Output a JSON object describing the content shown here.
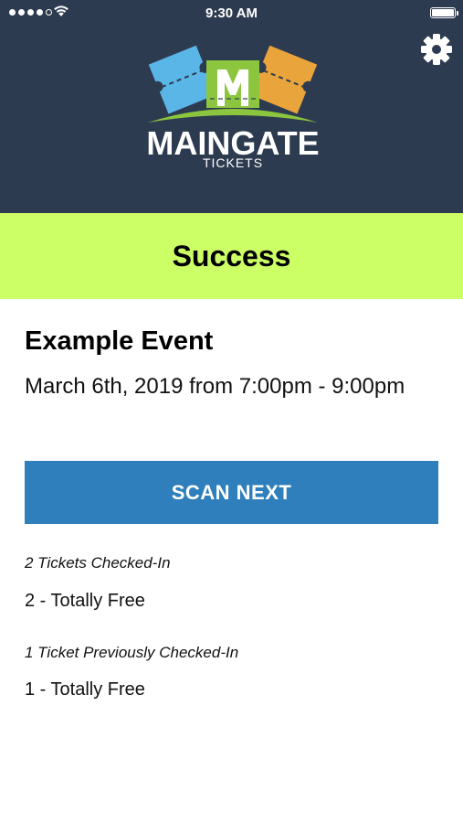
{
  "status_bar": {
    "time": "9:30 AM"
  },
  "header": {
    "logo": {
      "word": "MAINGATE",
      "subword": "TICKETS",
      "icon": "maingate-logo"
    },
    "settings_icon": "gear-icon"
  },
  "banner": {
    "text": "Success",
    "color": "#ccfe66"
  },
  "event": {
    "name": "Example Event",
    "date": "March 6th, 2019 from 7:00pm - 9:00pm"
  },
  "scan_button": {
    "label": "SCAN NEXT",
    "color": "#2e7fbb"
  },
  "checked_in": {
    "label": "2 Tickets Checked-In",
    "value": "2 - Totally Free"
  },
  "previously_checked_in": {
    "label": "1 Ticket Previously Checked-In",
    "value": "1 - Totally Free"
  },
  "colors": {
    "header_bg": "#2d3b50",
    "accent_blue": "#2e7fbb",
    "success_green": "#ccfe66"
  }
}
